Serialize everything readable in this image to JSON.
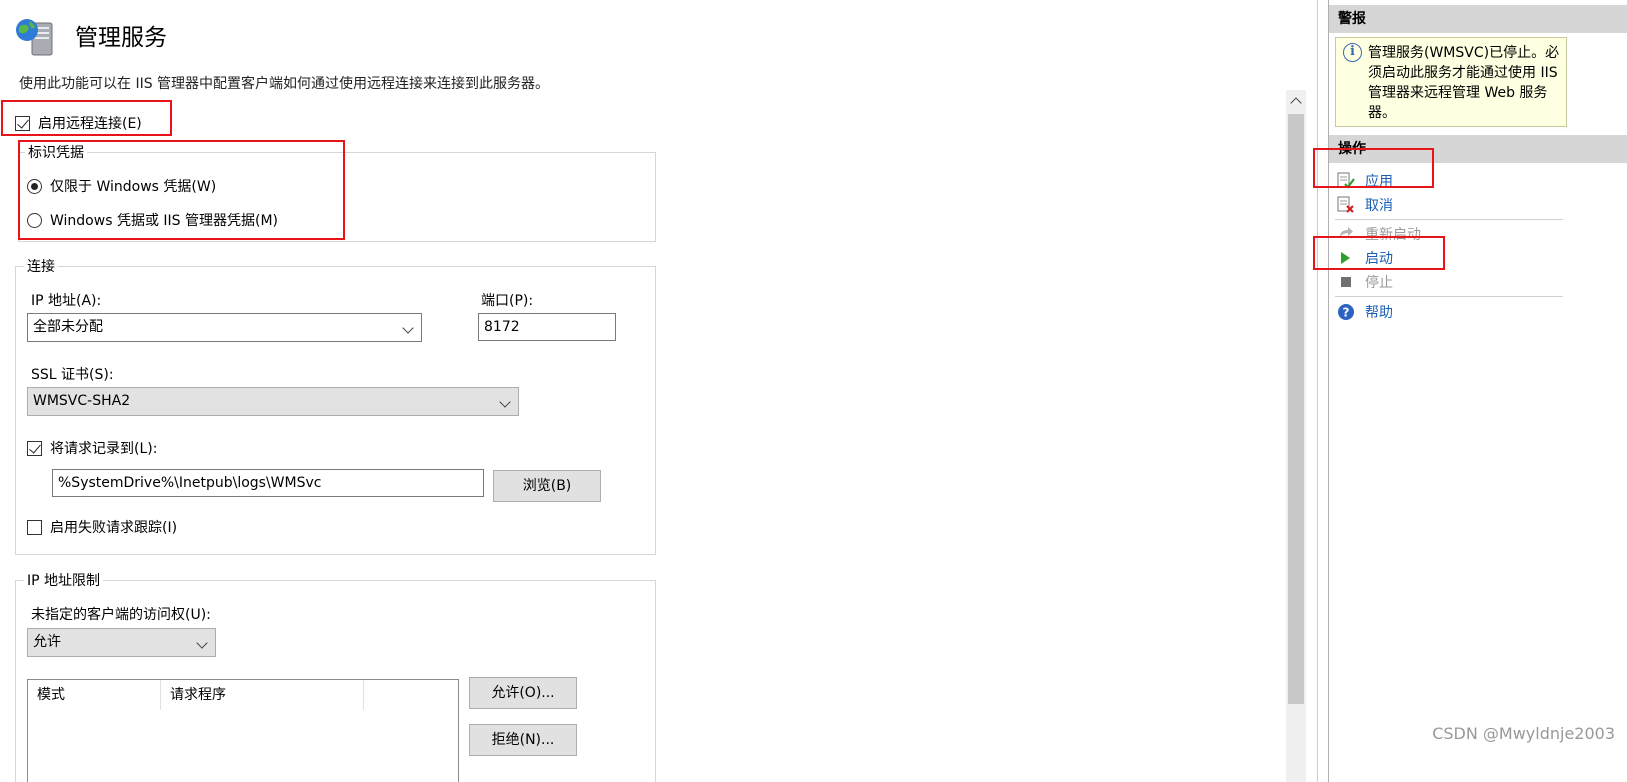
{
  "header": {
    "title": "管理服务",
    "description": "使用此功能可以在 IIS 管理器中配置客户端如何通过使用远程连接来连接到此服务器。"
  },
  "enable_remote": {
    "label": "启用远程连接(E)",
    "checked": true
  },
  "credentials": {
    "legend": "标识凭据",
    "options": [
      {
        "label": "仅限于 Windows 凭据(W)",
        "selected": true
      },
      {
        "label": "Windows 凭据或 IIS 管理器凭据(M)",
        "selected": false
      }
    ]
  },
  "connection": {
    "legend": "连接",
    "ip_label": "IP 地址(A):",
    "ip_value": "全部未分配",
    "port_label": "端口(P):",
    "port_value": "8172",
    "ssl_label": "SSL 证书(S):",
    "ssl_value": "WMSVC-SHA2",
    "log_label": "将请求记录到(L):",
    "log_checked": true,
    "log_path": "%SystemDrive%\\Inetpub\\logs\\WMSvc",
    "browse_label": "浏览(B)",
    "failed_trace_label": "启用失败请求跟踪(I)",
    "failed_trace_checked": false
  },
  "ip_restrictions": {
    "legend": "IP 地址限制",
    "access_label": "未指定的客户端的访问权(U):",
    "access_value": "允许",
    "columns": [
      "模式",
      "请求程序"
    ],
    "allow_label": "允许(O)...",
    "deny_label": "拒绝(N)..."
  },
  "right_panel": {
    "alerts_title": "警报",
    "alert_text": "管理服务(WMSVC)已停止。必须启动此服务才能通过使用 IIS 管理器来远程管理 Web 服务器。",
    "actions_title": "操作",
    "actions": {
      "apply": "应用",
      "cancel": "取消",
      "restart": "重新启动",
      "start": "启动",
      "stop": "停止",
      "help": "帮助"
    }
  },
  "watermark": "CSDN @Mwyldnje2003",
  "colors": {
    "highlight": "#e8141a",
    "link": "#1a5fb4",
    "disabled": "#9a9a9a",
    "alert_bg": "#ffffe1"
  }
}
